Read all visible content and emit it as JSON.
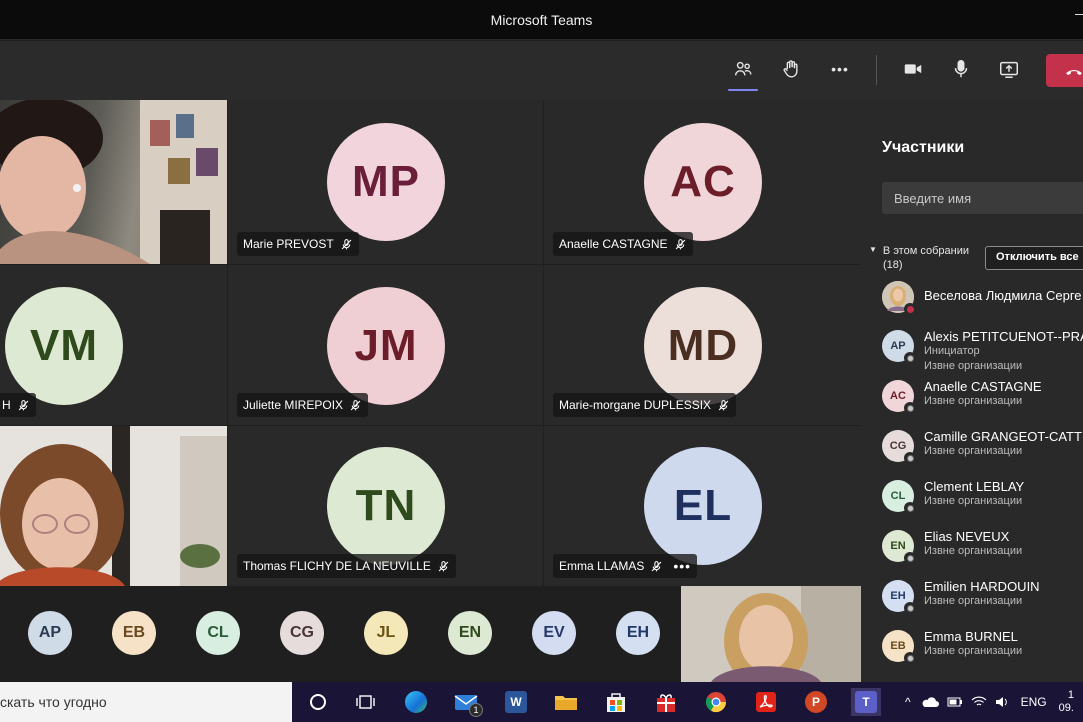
{
  "window": {
    "title": "Microsoft Teams"
  },
  "toolbar": {
    "buttons": [
      "participants-icon",
      "raise-hand-icon",
      "more-options-icon",
      "camera-icon",
      "microphone-icon",
      "share-screen-icon",
      "hang-up-icon"
    ],
    "more_label": "•••"
  },
  "colors": {
    "accent": "#7f85f5",
    "hangup": "#c4314b",
    "panel_bg": "#292929",
    "stage_bg": "#1f1f1f"
  },
  "tiles": [
    {
      "initials": "MP",
      "name": "Marie PREVOST",
      "bg": "#f1d4dc",
      "fg": "#6b1e3a"
    },
    {
      "initials": "AC",
      "name": "Anaelle CASTAGNE",
      "bg": "#f0d6d8",
      "fg": "#6b1e2a"
    },
    {
      "initials": "VM",
      "name": "H",
      "bg": "#dde9d2",
      "fg": "#2f4a1c"
    },
    {
      "initials": "JM",
      "name": "Juliette MIREPOIX",
      "bg": "#efcfd4",
      "fg": "#6b1e2a"
    },
    {
      "initials": "MD",
      "name": "Marie-morgane DUPLESSIX",
      "bg": "#ecdfd9",
      "fg": "#4a2e22"
    },
    {
      "initials": "TN",
      "name": "Thomas FLICHY DE LA NEUVILLE",
      "bg": "#dde9d2",
      "fg": "#2f4a1c"
    },
    {
      "initials": "EL",
      "name": "Emma LLAMAS",
      "bg": "#cfd9ee",
      "fg": "#1f2f5e"
    }
  ],
  "strip": [
    {
      "initials": "AP",
      "bg": "#cfdbe6",
      "fg": "#2a3b52"
    },
    {
      "initials": "EB",
      "bg": "#f6e3c7",
      "fg": "#6a4a1f"
    },
    {
      "initials": "CL",
      "bg": "#d8eee0",
      "fg": "#285c3a"
    },
    {
      "initials": "CG",
      "bg": "#e6dcdc",
      "fg": "#4a3434"
    },
    {
      "initials": "JL",
      "bg": "#f4e7b8",
      "fg": "#6a5214"
    },
    {
      "initials": "EN",
      "bg": "#dde9d2",
      "fg": "#2f4a1c"
    },
    {
      "initials": "EV",
      "bg": "#d4dcf2",
      "fg": "#27386a"
    },
    {
      "initials": "EH",
      "bg": "#d4e0f2",
      "fg": "#223a66"
    }
  ],
  "panel": {
    "title": "Участники",
    "search_placeholder": "Введите имя",
    "section_label": "В этом собрании",
    "section_count": "(18)",
    "mute_all": "Отключить все",
    "participants": [
      {
        "initials": "",
        "name": "Веселова Людмила Серге",
        "role": "",
        "org": "",
        "bg": "#d9c7a6",
        "fg": "#3a2a10",
        "photo": true,
        "busy": true
      },
      {
        "initials": "AP",
        "name": "Alexis PETITCUENOT--PRA",
        "role": "Инициатор",
        "org": "Извне организации",
        "bg": "#cfdbe6",
        "fg": "#2a3b52"
      },
      {
        "initials": "AC",
        "name": "Anaelle CASTAGNE",
        "role": "",
        "org": "Извне организации",
        "bg": "#f0d6d8",
        "fg": "#6b1e2a"
      },
      {
        "initials": "CG",
        "name": "Camille GRANGEOT-CATT",
        "role": "",
        "org": "Извне организации",
        "bg": "#e6dcdc",
        "fg": "#4a3434"
      },
      {
        "initials": "CL",
        "name": "Clement LEBLAY",
        "role": "",
        "org": "Извне организации",
        "bg": "#d8eee0",
        "fg": "#285c3a"
      },
      {
        "initials": "EN",
        "name": "Elias NEVEUX",
        "role": "",
        "org": "Извне организации",
        "bg": "#dde9d2",
        "fg": "#2f4a1c"
      },
      {
        "initials": "EH",
        "name": "Emilien HARDOUIN",
        "role": "",
        "org": "Извне организации",
        "bg": "#d4e0f2",
        "fg": "#223a66"
      },
      {
        "initials": "EB",
        "name": "Emma BURNEL",
        "role": "",
        "org": "Извне организации",
        "bg": "#f6e3c7",
        "fg": "#6a4a1f"
      }
    ]
  },
  "taskbar": {
    "search_text": "скать что угодно",
    "mail_badge": "1",
    "word_letter": "W",
    "powerpoint_letter": "P",
    "teams_letter": "T",
    "language": "ENG",
    "clock_time": "1",
    "clock_date": "09."
  }
}
